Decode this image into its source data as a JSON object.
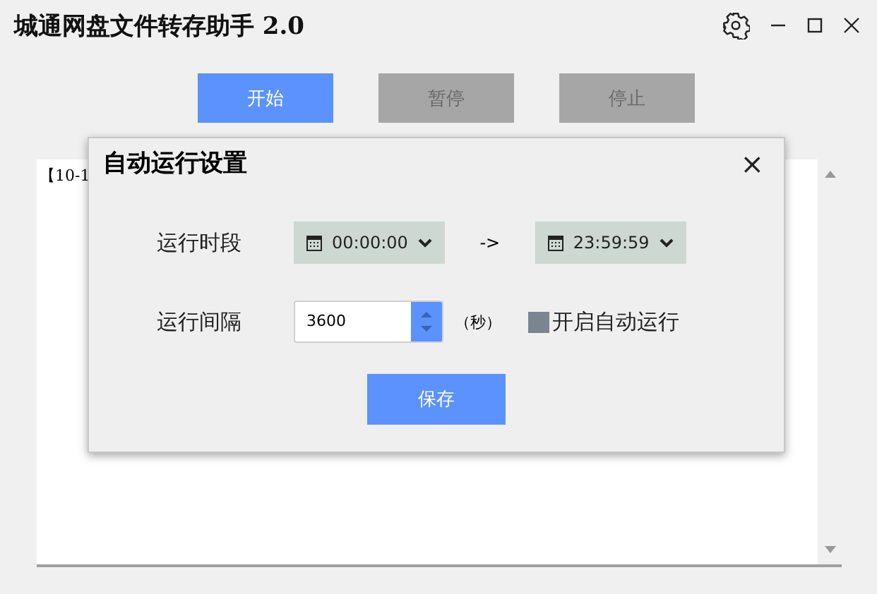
{
  "window": {
    "title": "城通网盘文件转存助手 2.0"
  },
  "toolbar": [
    {
      "label": "开始",
      "disabled": false
    },
    {
      "label": "暂停",
      "disabled": true
    },
    {
      "label": "停止",
      "disabled": true
    }
  ],
  "log": {
    "lines": [
      "【10-1"
    ]
  },
  "dialog": {
    "title": "自动运行设置",
    "close": "×",
    "period": {
      "label": "运行时段",
      "start": "00:00:00",
      "arrow": "->",
      "end": "23:59:59"
    },
    "interval": {
      "label": "运行间隔",
      "value": "3600",
      "unit": "（秒）"
    },
    "auto_run": {
      "label": "开启自动运行",
      "checked": false
    },
    "save": "保存"
  }
}
